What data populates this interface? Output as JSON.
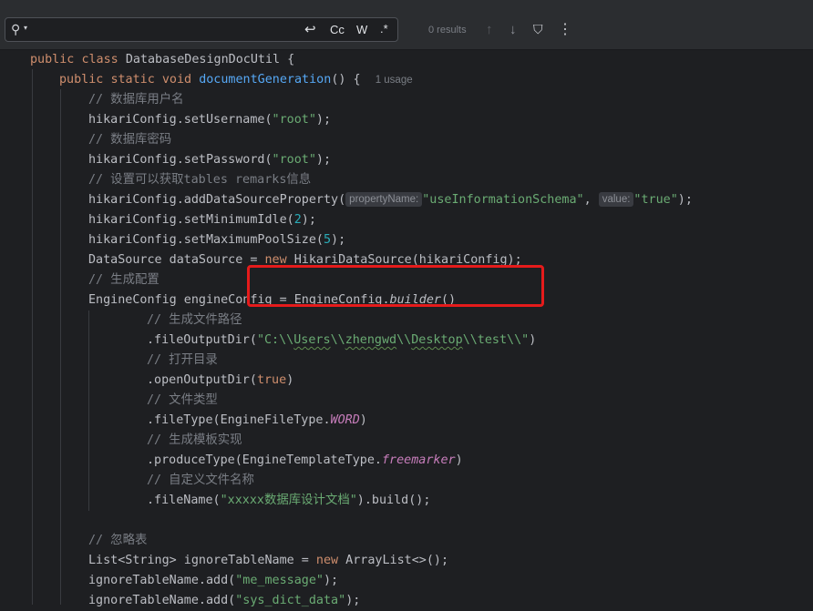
{
  "search": {
    "query": "",
    "match_case_label": "Cc",
    "whole_word_label": "W",
    "regex_label": ".*",
    "results": "0 results"
  },
  "code": {
    "l1": [
      "public",
      "class",
      "DatabaseDesignDocUtil {"
    ],
    "l2": [
      "public",
      "static",
      "void",
      "documentGeneration",
      "() {",
      "1 usage"
    ],
    "l3": "// 数据库用户名",
    "l4": [
      "hikariConfig.setUsername(",
      "\"root\"",
      ");"
    ],
    "l5": "// 数据库密码",
    "l6": [
      "hikariConfig.setPassword(",
      "\"root\"",
      ");"
    ],
    "l7": "// 设置可以获取tables remarks信息",
    "l8": [
      "hikariConfig.addDataSourceProperty(",
      "propertyName:",
      "\"useInformationSchema\"",
      ", ",
      "value:",
      "\"true\"",
      ");"
    ],
    "l9": [
      "hikariConfig.setMinimumIdle(",
      "2",
      ");"
    ],
    "l10": [
      "hikariConfig.setMaximumPoolSize(",
      "5",
      ");"
    ],
    "l11": [
      "DataSource dataSource = ",
      "new",
      " HikariDataSource(hikariConfig);"
    ],
    "l12": "// 生成配置",
    "l13": [
      "EngineConfig engineConfig = EngineConfig.",
      "builder",
      "()"
    ],
    "l14": "// 生成文件路径",
    "l15": [
      ".fileOutputDir(",
      "\"C:\\\\",
      "Users",
      "\\\\",
      "zhengwd",
      "\\\\",
      "Desktop",
      "\\\\test\\\\\"",
      ")"
    ],
    "l16": "// 打开目录",
    "l17": [
      ".openOutputDir(",
      "true",
      ")"
    ],
    "l18": "// 文件类型",
    "l19": [
      ".fileType(EngineFileType.",
      "WORD",
      ")"
    ],
    "l20": "// 生成模板实现",
    "l21": [
      ".produceType(EngineTemplateType.",
      "freemarker",
      ")"
    ],
    "l22": "// 自定义文件名称",
    "l23": [
      ".fileName(",
      "\"xxxxx数据库设计文档\"",
      ").build();"
    ],
    "l25": "// 忽略表",
    "l26": [
      "List<String> ignoreTableName = ",
      "new",
      " ArrayList<>();"
    ],
    "l27": [
      "ignoreTableName.add(",
      "\"me_message\"",
      ");"
    ],
    "l28": [
      "ignoreTableName.add(",
      "\"sys_dict_data\"",
      ");"
    ]
  },
  "colors": {
    "background": "#1e1f22",
    "keyword": "#cf8e6d",
    "string": "#6aab73",
    "method": "#56a8f5",
    "number": "#2aacb8",
    "comment": "#7a7e85",
    "highlight_box": "#e51b1b"
  },
  "icons": [
    "search-icon",
    "history-dropdown-icon",
    "new-line-icon",
    "previous-occurrence-icon",
    "next-occurrence-icon",
    "filter-icon",
    "more-options-icon"
  ]
}
